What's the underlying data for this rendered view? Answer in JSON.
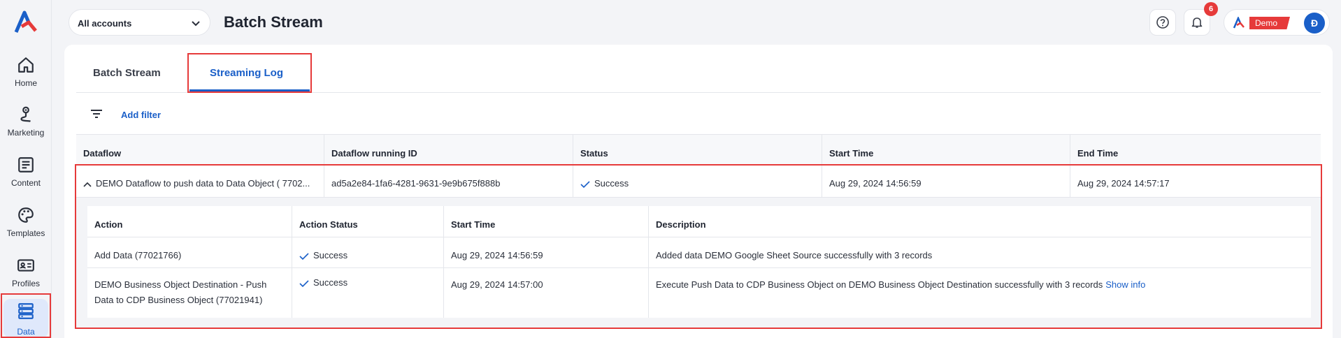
{
  "app": {
    "logo": "brand-logo"
  },
  "sidebar": {
    "items": [
      {
        "label": "Home",
        "icon": "home-icon"
      },
      {
        "label": "Marketing",
        "icon": "route-icon"
      },
      {
        "label": "Content",
        "icon": "document-icon"
      },
      {
        "label": "Templates",
        "icon": "palette-icon"
      },
      {
        "label": "Profiles",
        "icon": "id-card-icon"
      },
      {
        "label": "Data",
        "icon": "database-icon",
        "active": true
      }
    ]
  },
  "header": {
    "account_select": "All accounts",
    "title": "Batch Stream",
    "notifications_count": "6",
    "demo_tag": "Demo",
    "avatar_initial": "Đ"
  },
  "tabs": [
    {
      "label": "Batch Stream"
    },
    {
      "label": "Streaming Log",
      "active": true
    }
  ],
  "filter": {
    "add_filter_label": "Add filter"
  },
  "table": {
    "columns": [
      "Dataflow",
      "Dataflow running ID",
      "Status",
      "Start Time",
      "End Time"
    ],
    "row": {
      "dataflow": "DEMO Dataflow to push data to Data Object ( 7702...",
      "running_id": "ad5a2e84-1fa6-4281-9631-9e9b675f888b",
      "status": "Success",
      "start_time": "Aug 29, 2024 14:56:59",
      "end_time": "Aug 29, 2024 14:57:17"
    }
  },
  "nested_table": {
    "columns": [
      "Action",
      "Action Status",
      "Start Time",
      "Description"
    ],
    "rows": [
      {
        "action": "Add Data (77021766)",
        "status": "Success",
        "start_time": "Aug 29, 2024 14:56:59",
        "description": "Added data DEMO Google Sheet Source successfully with 3 records"
      },
      {
        "action_line1": "DEMO Business Object Destination - Push",
        "action_line2": "Data to CDP Business Object (77021941)",
        "status": "Success",
        "start_time": "Aug 29, 2024 14:57:00",
        "description": "Execute Push Data to CDP Business Object on DEMO Business Object Destination successfully with 3 records",
        "link": "Show info"
      }
    ]
  },
  "colors": {
    "accent": "#1a5fc8",
    "highlight": "#e63a3a",
    "success": "#1a5fc8"
  }
}
